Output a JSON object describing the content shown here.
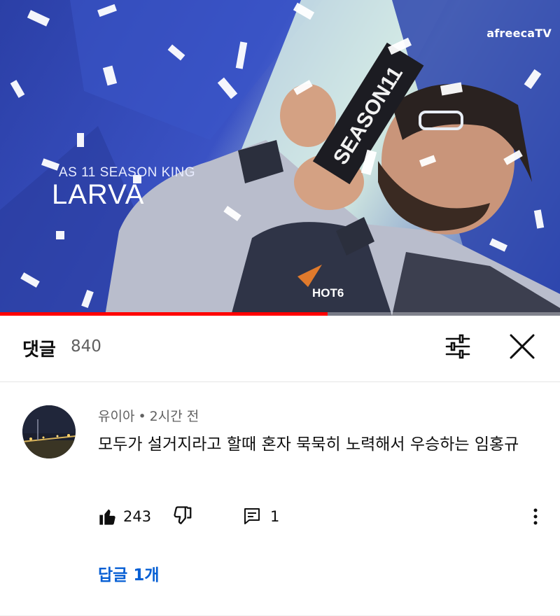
{
  "video": {
    "brand": "afreecaTV",
    "overlay_subtitle": "AS 11 SEASON KING",
    "overlay_title": "LARVA",
    "trophy_text": "SEASON11",
    "jersey_text": "HOT6",
    "progress": 0.585,
    "progress_color": "#ff0000"
  },
  "comments_panel": {
    "label": "댓글",
    "count": "840",
    "sort_icon": "tune-icon",
    "close_icon": "close-icon"
  },
  "comment": {
    "author": "유이아",
    "separator": "•",
    "time": "2시간 전",
    "text": "모두가 설거지라고 할때 혼자 묵묵히 노력해서 우승하는 임홍규",
    "likes": "243",
    "reply_count": "1",
    "replies_link": "답글 1개"
  },
  "colors": {
    "accent_link": "#065fd4",
    "text_primary": "#0f0f0f",
    "text_secondary": "#606060"
  }
}
